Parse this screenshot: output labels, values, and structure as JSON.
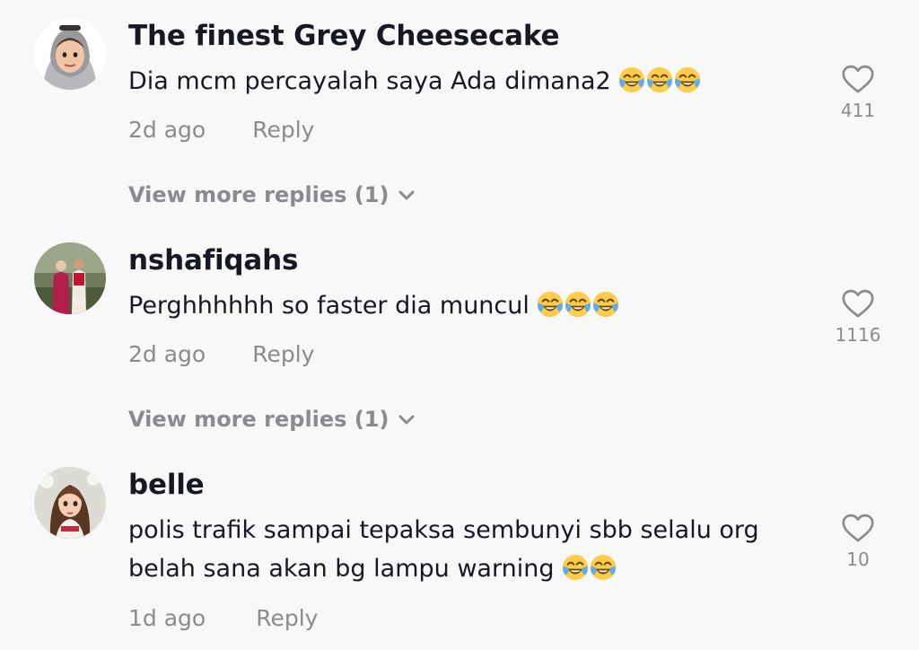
{
  "comments": [
    {
      "username": "The finest Grey Cheesecake",
      "text": "Dia mcm percayalah saya Ada dimana2",
      "emojis": [
        "face-with-tears-of-joy",
        "face-with-tears-of-joy",
        "face-with-tears-of-joy"
      ],
      "time": "2d ago",
      "reply_label": "Reply",
      "likes": "411",
      "view_more": "View more replies (1)"
    },
    {
      "username": "nshafiqahs",
      "text": "Perghhhhhh so faster dia muncul",
      "emojis": [
        "face-with-tears-of-joy",
        "face-with-tears-of-joy",
        "face-with-tears-of-joy"
      ],
      "time": "2d ago",
      "reply_label": "Reply",
      "likes": "1116",
      "view_more": "View more replies (1)"
    },
    {
      "username": "belle",
      "text_line1": "polis trafik sampai tepaksa sembunyi sbb selalu org",
      "text_line2": "belah sana akan bg lampu warning",
      "emojis": [
        "face-with-tears-of-joy",
        "face-with-tears-of-joy"
      ],
      "time": "1d ago",
      "reply_label": "Reply",
      "likes": "10"
    }
  ],
  "colors": {
    "background": "#f8f8f8",
    "primary_text": "#161823",
    "secondary_text": "#8a8b91"
  }
}
